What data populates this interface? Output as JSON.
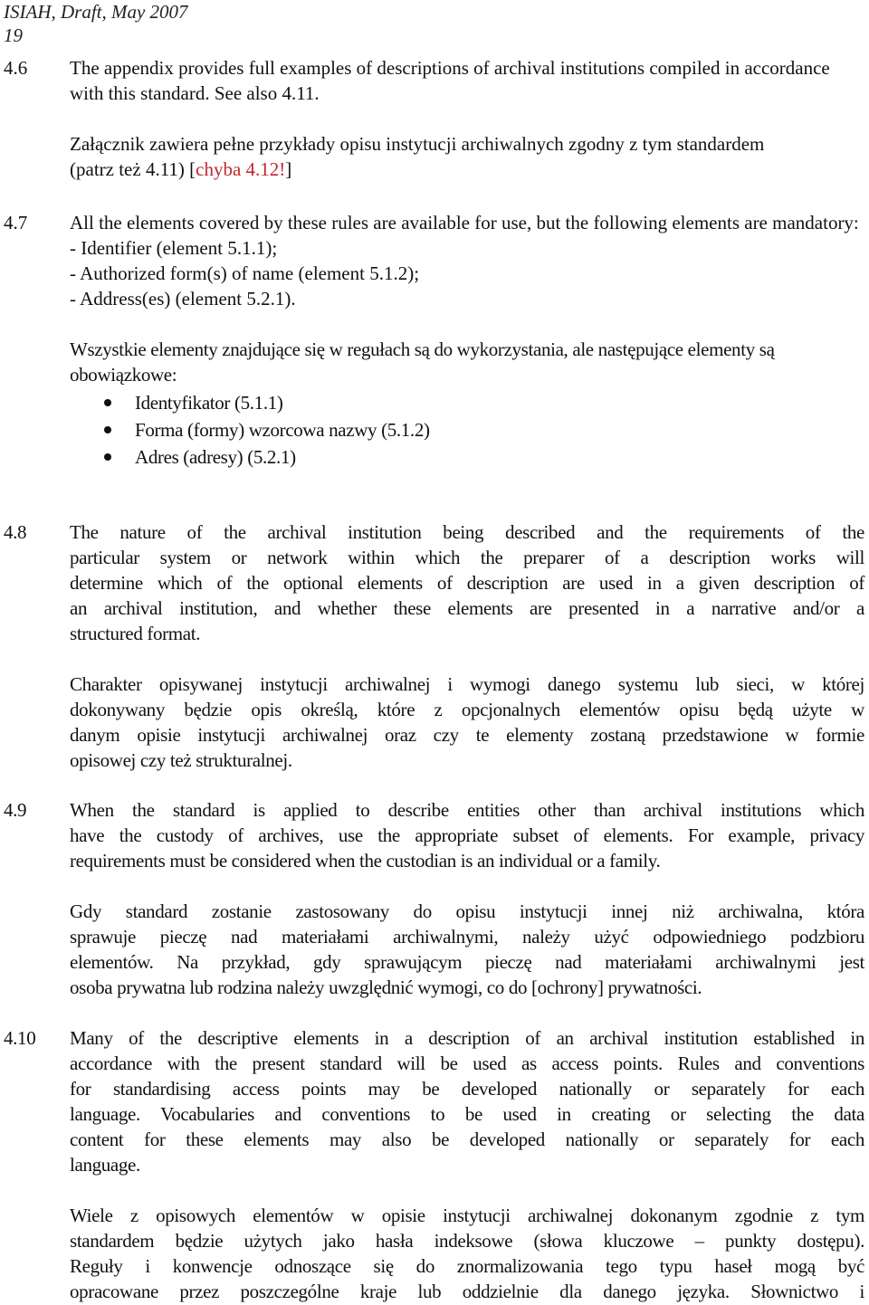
{
  "header": {
    "title": "ISIAH, Draft, May 2007",
    "page_number": "19"
  },
  "sections": {
    "s46": {
      "number": "4.6",
      "en": "The appendix provides full examples of descriptions of archival institutions compiled in accordance with this standard. See also 4.11.",
      "pl_main": "Załącznik zawiera pełne przykłady opisu instytucji archiwalnych zgodny z tym standardem (patrz też 4.11) [",
      "pl_comment": "chyba 4.12!",
      "pl_close": "]"
    },
    "s47": {
      "number": "4.7",
      "en_intro": "All the elements covered by these rules are available for use, but the following elements are mandatory:",
      "en_items": [
        "- Identifier (element 5.1.1);",
        "- Authorized form(s) of name (element 5.1.2);",
        "- Address(es) (element 5.2.1)."
      ],
      "pl_intro": "Wszystkie elementy znajdujące się w regułach są do wykorzystania, ale następujące elementy są obowiązkowe:",
      "pl_items": [
        "Identyfikator (5.1.1)",
        "Forma (formy) wzorcowa nazwy (5.1.2)",
        "Adres (adresy) (5.2.1)"
      ]
    },
    "s48": {
      "number": "4.8",
      "en_lines": [
        "The nature of the archival institution being described and the requirements of the",
        "particular system or network within which the preparer of a description works will",
        "determine which of the optional elements of description are used in a given description of",
        "an archival institution, and whether these elements are presented in a narrative and/or a",
        "structured format."
      ],
      "pl_lines": [
        "Charakter opisywanej instytucji archiwalnej i wymogi danego systemu lub sieci, w której",
        "dokonywany będzie opis określą, które z opcjonalnych elementów opisu będą użyte w",
        "danym opisie instytucji archiwalnej oraz czy te elementy zostaną przedstawione w formie",
        "opisowej czy też strukturalnej."
      ]
    },
    "s49": {
      "number": "4.9",
      "en_lines": [
        "When the standard is applied to describe entities other than archival institutions which",
        "have the custody of archives, use the appropriate subset of elements. For example, privacy",
        "requirements must be considered when the custodian is an individual or a family."
      ],
      "pl_lines": [
        "Gdy standard zostanie zastosowany do opisu instytucji innej niż archiwalna, która",
        "sprawuje pieczę nad materiałami archiwalnymi, należy użyć odpowiedniego podzbioru",
        "elementów. Na przykład, gdy sprawującym pieczę nad materiałami archiwalnymi jest",
        "osoba prywatna lub rodzina należy uwzględnić wymogi, co do [ochrony] prywatności."
      ]
    },
    "s410": {
      "number": "4.10",
      "en_lines": [
        "Many of the descriptive elements in a description of an archival institution established in",
        "accordance with the present standard will be used as access points. Rules and conventions",
        "for standardising access points may be developed nationally or separately for each",
        "language. Vocabularies and conventions to be used in creating or selecting the data",
        "content for these elements may also be developed nationally or separately for each",
        "language."
      ],
      "pl_lines": [
        "Wiele z opisowych elementów w opisie instytucji archiwalnej dokonanym zgodnie z tym",
        "standardem będzie użytych jako hasła indeksowe (słowa kluczowe – punkty dostępu).",
        "Reguły i konwencje odnoszące się do znormalizowania tego typu haseł mogą być",
        "opracowane przez poszczególne kraje lub oddzielnie dla danego języka. Słownictwo i"
      ]
    }
  },
  "colors": {
    "text": "#111111",
    "comment": "#c0272d"
  }
}
